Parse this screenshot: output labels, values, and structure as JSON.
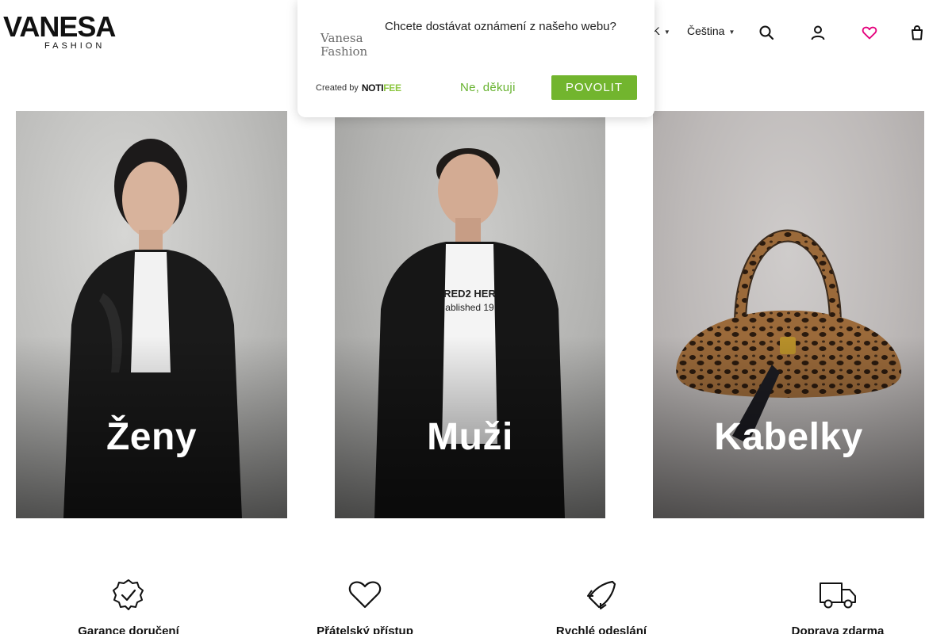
{
  "brand": {
    "name": "VANESA",
    "tagline": "FASHION"
  },
  "header": {
    "currency": "ZK",
    "language": "Čeština",
    "icons": [
      "search-icon",
      "user-icon",
      "heart-icon",
      "cart-icon"
    ],
    "wishlist_color": "#e4007c"
  },
  "popup": {
    "logo_line1": "Vanesa",
    "logo_line2": "Fashion",
    "question": "Chcete dostávat oznámení z našeho webu?",
    "created_by": "Created by",
    "provider_part1": "NOTI",
    "provider_part2": "FEE",
    "decline_label": "Ne, děkuji",
    "accept_label": "POVOLIT",
    "accent_color": "#72b52e"
  },
  "categories": [
    {
      "label": "Ženy"
    },
    {
      "label": "Muži"
    },
    {
      "label": "Kabelky"
    }
  ],
  "features": [
    {
      "icon": "badge-check-icon",
      "title": "Garance doručení"
    },
    {
      "icon": "heart-outline-icon",
      "title": "Přátelský přístup"
    },
    {
      "icon": "rocket-icon",
      "title": "Rychlé odeslání"
    },
    {
      "icon": "delivery-truck-icon",
      "title": "Doprava zdarma"
    }
  ]
}
